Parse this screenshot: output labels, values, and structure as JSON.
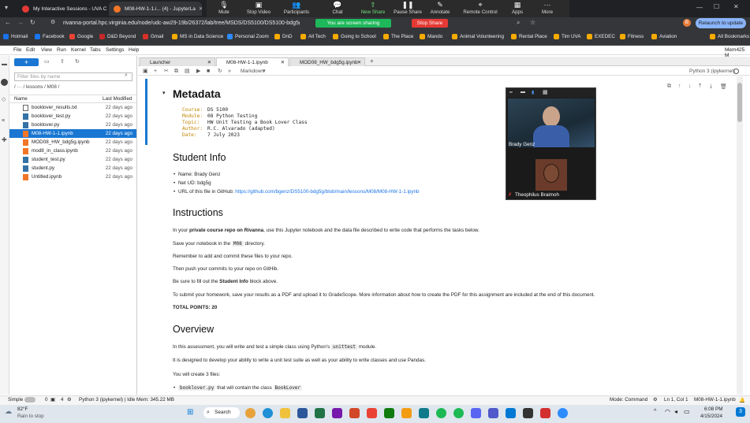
{
  "browser": {
    "tabs": [
      {
        "title": "My Interactive Sessions - UVA C",
        "active": false
      },
      {
        "title": "M08-HW-1-1.i... (4) - JupyterLa",
        "active": true
      }
    ],
    "url": "rivanna-portal.hpc.virginia.edu/node/udc-aw29-19b/26372/lab/tree/MSDS/DS5100/DS5100-bdg5g/",
    "relaunch": "Relaunch to update",
    "bookmarks": [
      "Hotmail",
      "Facebook",
      "Google",
      "D&D Beyond",
      "Gmail",
      "MS in Data Science",
      "Personal Zoom",
      "DnD",
      "All Tech",
      "Going to School",
      "The Place",
      "Mando",
      "Animal Volunteering",
      "Rental Place",
      "Tim UVA",
      "EXEDEC",
      "Fitness",
      "Aviation",
      "All Bookmarks"
    ]
  },
  "zoom": {
    "controls": [
      {
        "label": "Mute",
        "icon": "microphone-icon"
      },
      {
        "label": "Stop Video",
        "icon": "video-camera-icon"
      },
      {
        "label": "Participants",
        "icon": "participants-icon",
        "count": "2"
      },
      {
        "label": "Chat",
        "icon": "chat-icon"
      },
      {
        "label": "New Share",
        "icon": "share-icon"
      },
      {
        "label": "Pause Share",
        "icon": "pause-icon"
      },
      {
        "label": "Annotate",
        "icon": "pencil-icon"
      },
      {
        "label": "Remote Control",
        "icon": "remote-control-icon"
      },
      {
        "label": "Apps",
        "icon": "apps-icon"
      },
      {
        "label": "More",
        "icon": "more-icon"
      }
    ],
    "sharing_banner": "You are screen sharing",
    "stop_share": "Stop Share",
    "participants": [
      "Brady Genz",
      "Theophilus Braimoh"
    ]
  },
  "jupyter": {
    "menu": [
      "File",
      "Edit",
      "View",
      "Run",
      "Kernel",
      "Tabs",
      "Settings",
      "Help"
    ],
    "mem_top": "Mem425 M",
    "filter_placeholder": "Filter files by name",
    "breadcrumb": "/ ··· / lessons / M08 /",
    "col_name": "Name",
    "col_modified": "Last Modified",
    "files": [
      {
        "name": "booklover_results.txt",
        "modified": "22 days ago",
        "selected": false,
        "type": "text"
      },
      {
        "name": "booklover_test.py",
        "modified": "22 days ago",
        "selected": false,
        "type": "py"
      },
      {
        "name": "booklover.py",
        "modified": "22 days ago",
        "selected": false,
        "type": "py"
      },
      {
        "name": "M08-HW-1-1.ipynb",
        "modified": "22 days ago",
        "selected": true,
        "type": "nb"
      },
      {
        "name": "MOD08_HW_bdg5g.ipynb",
        "modified": "22 days ago",
        "selected": false,
        "type": "nb"
      },
      {
        "name": "mod8_in_class.ipynb",
        "modified": "22 days ago",
        "selected": false,
        "type": "nb"
      },
      {
        "name": "student_test.py",
        "modified": "22 days ago",
        "selected": false,
        "type": "py"
      },
      {
        "name": "student.py",
        "modified": "22 days ago",
        "selected": false,
        "type": "py"
      },
      {
        "name": "Untitled.ipynb",
        "modified": "22 days ago",
        "selected": false,
        "type": "nb"
      }
    ],
    "doc_tabs": [
      "Launcher",
      "M08-HW-1-1.ipynb",
      "MOD08_HW_bdg5g.ipynb"
    ],
    "cell_type": "Markdown",
    "kernel": "Python 3 (ipykernel)",
    "status": {
      "mode_simple": "Simple",
      "count0": "0",
      "count4": "4",
      "kernel_idle": "Python 3 (ipykernel) | Idle",
      "mem": "Mem: 345.22 MB",
      "mode": "Mode: Command",
      "position": "Ln 1, Col 1",
      "file": "M08-HW-1-1.ipynb"
    }
  },
  "notebook": {
    "metadata_title": "Metadata",
    "metadata": [
      {
        "key": "Course:",
        "value": "DS 5100"
      },
      {
        "key": "Module:",
        "value": "08 Python Testing"
      },
      {
        "key": "Topic:",
        "value": "HW Unit Testing a Book Lover Class"
      },
      {
        "key": "Author:",
        "value": "R.C. Alvarado (adapted)"
      },
      {
        "key": "Date:",
        "value": "7 July 2023"
      }
    ],
    "student_title": "Student Info",
    "student": {
      "name": "Name: Brady Genz",
      "netid": "Net UD: bdg5g",
      "url_prefix": "URL of this file in GitHub: ",
      "url": "https://github.com/bgenz/DS5100-bdg5g/blob/main/lessons/M08/M08-HW-1-1.ipynb"
    },
    "instructions_title": "Instructions",
    "instr1_a": "In your ",
    "instr1_b": "private course repo on Rivanna",
    "instr1_c": ", use this Jupyter notebook and the data file described to write code that performs the tasks below.",
    "instr2_a": "Save your notebook in the ",
    "instr2_code": "M08",
    "instr2_b": " directory.",
    "instr3": "Remember to add and commit these files to your repo.",
    "instr4": "Then push your commits to your repo on GitHib.",
    "instr5_a": "Be sure to fill out the ",
    "instr5_b": "Student Info",
    "instr5_c": " block above.",
    "instr6": "To submit your homework, save your results as a PDF and upload it to GradeScope. More information about how to create the PDF for this assignment are included at the end of this document.",
    "total": "TOTAL POINTS: 20",
    "overview_title": "Overview",
    "ov1_a": "In this assessment, you will write and test a simple class using Python's ",
    "ov1_code": "unittest",
    "ov1_b": " module.",
    "ov2": "It is designed to develop your ability to write a unit test suite as well as your ability to write classes and use Pandas.",
    "ov3": "You will create 3 files:",
    "ov_item_code": "booklover.py",
    "ov_item_mid": " that will contain the class ",
    "ov_item_code2": "BookLover"
  },
  "taskbar": {
    "temp": "82°F",
    "weather": "Rain to stop",
    "search": "Search",
    "time": "6:08 PM",
    "date": "4/15/2024"
  }
}
